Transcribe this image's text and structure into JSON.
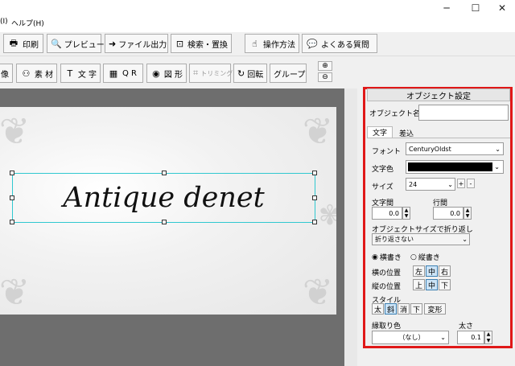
{
  "menu": {
    "item1": "(I)",
    "help": "ヘルプ(H)"
  },
  "window": {
    "minimize": "─",
    "maximize": "☐",
    "close": "✕"
  },
  "toolbar1": {
    "print": "印刷",
    "preview": "プレビュー",
    "file_output": "ファイル出力",
    "search_replace": "検索・置換",
    "howto": "操作方法",
    "faq": "よくある質問"
  },
  "toolbar2": {
    "image": "像",
    "material": "素 材",
    "text": "文 字",
    "qr": "Q R",
    "shape": "図 形",
    "trim": "トリミング",
    "rotate": "回転",
    "group": "グループ"
  },
  "canvas": {
    "main_text": "Antique denet"
  },
  "panel": {
    "title": "オブジェクト設定",
    "object_name_label": "オブジェクト名",
    "object_name_value": "",
    "tabs": [
      "文字",
      "差込"
    ],
    "font_label": "フォント",
    "font_value": "CenturyOldst",
    "color_label": "文字色",
    "color_value": "#000000",
    "size_label": "サイズ",
    "size_value": "24",
    "plus": "+",
    "minus": "-",
    "char_spacing_label": "文字間",
    "char_spacing_value": "0.0",
    "line_spacing_label": "行間",
    "line_spacing_value": "0.0",
    "wrap_label": "オブジェクトサイズで折り返し",
    "wrap_value": "折り返さない",
    "horizontal_writing": "横書き",
    "vertical_writing": "縦書き",
    "h_pos_label": "横の位置",
    "h_pos": [
      "左",
      "中",
      "右"
    ],
    "v_pos_label": "縦の位置",
    "v_pos": [
      "上",
      "中",
      "下"
    ],
    "style_label": "スタイル",
    "styles": [
      "太",
      "斜",
      "消",
      "下",
      "変形"
    ],
    "outline_label": "縁取り色",
    "outline_value": "（なし）",
    "thickness_label": "太さ",
    "thickness_value": "0.1"
  },
  "colors": {
    "highlight": "#e01818",
    "selection": "#30c8d0"
  }
}
